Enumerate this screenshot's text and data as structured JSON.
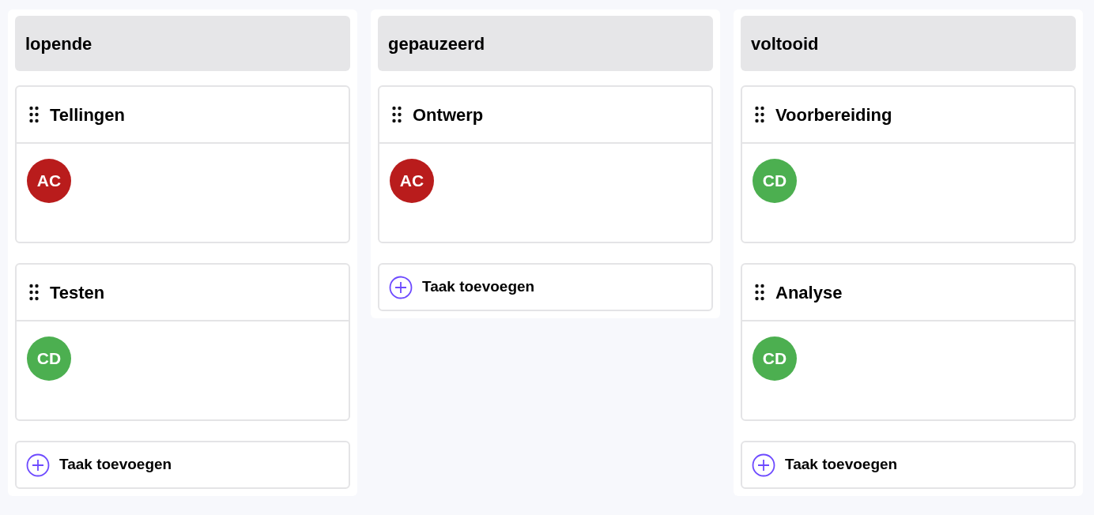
{
  "columns": [
    {
      "title": "lopende",
      "cards": [
        {
          "title": "Tellingen",
          "assignee": {
            "initials": "AC",
            "color": "#b91c1c"
          }
        },
        {
          "title": "Testen",
          "assignee": {
            "initials": "CD",
            "color": "#4caf50"
          }
        }
      ],
      "add_label": "Taak toevoegen"
    },
    {
      "title": "gepauzeerd",
      "cards": [
        {
          "title": "Ontwerp",
          "assignee": {
            "initials": "AC",
            "color": "#b91c1c"
          }
        }
      ],
      "add_label": "Taak toevoegen"
    },
    {
      "title": "voltooid",
      "cards": [
        {
          "title": "Voorbereiding",
          "assignee": {
            "initials": "CD",
            "color": "#4caf50"
          }
        },
        {
          "title": "Analyse",
          "assignee": {
            "initials": "CD",
            "color": "#4caf50"
          }
        }
      ],
      "add_label": "Taak toevoegen"
    }
  ]
}
